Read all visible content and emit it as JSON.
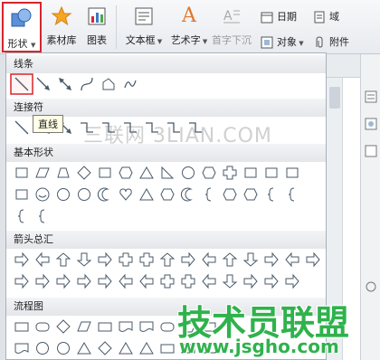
{
  "ribbon": {
    "shapes": "形状",
    "material_library": "素材库",
    "chart": "图表",
    "text_box": "文本框",
    "art_text": "艺术字",
    "drop_cap": "首字下沉",
    "date": "日期",
    "domain": "域",
    "object": "对象",
    "attachment": "附件"
  },
  "panel": {
    "sections": [
      "线条",
      "连接符",
      "基本形状",
      "箭头总汇",
      "流程图"
    ]
  },
  "tooltip": "直线",
  "watermark": {
    "site_cn": "三联网 3LIAN.COM",
    "brand": "技术员联盟",
    "url": "www.jsgho.com"
  },
  "colors": {
    "highlight": "#d6262b",
    "watermark_green": "#2fb24c",
    "shape_stroke": "#4a5a6a"
  }
}
